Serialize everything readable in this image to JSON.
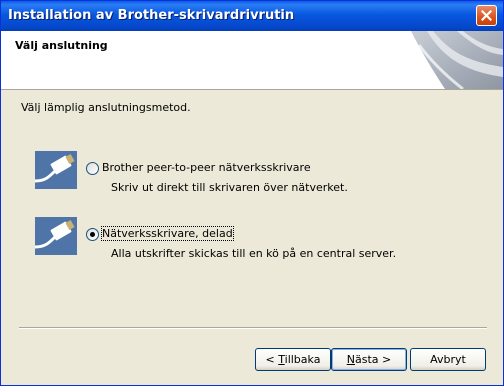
{
  "window": {
    "title": "Installation av Brother-skrivardrivrutin"
  },
  "header": {
    "title": "Välj anslutning"
  },
  "instruction": "Välj lämplig anslutningsmetod.",
  "options": [
    {
      "label": "Brother peer-to-peer nätverksskrivare",
      "description": "Skriv ut direkt till skrivaren över nätverket.",
      "selected": false,
      "icon": "network-cable-icon"
    },
    {
      "label": "Nätverksskrivare, delad",
      "description": "Alla utskrifter skickas till en kö på en central server.",
      "selected": true,
      "icon": "network-cable-icon"
    }
  ],
  "buttons": {
    "back": {
      "prefix": "< ",
      "mnemonic": "T",
      "rest": "illbaka"
    },
    "next": {
      "prefix": "",
      "mnemonic": "N",
      "rest": "ästa >"
    },
    "cancel": {
      "label": "Avbryt"
    }
  },
  "colors": {
    "titlebar": "#0858e0",
    "dialog_bg": "#ece9d8",
    "icon_bg": "#4f74a8"
  }
}
